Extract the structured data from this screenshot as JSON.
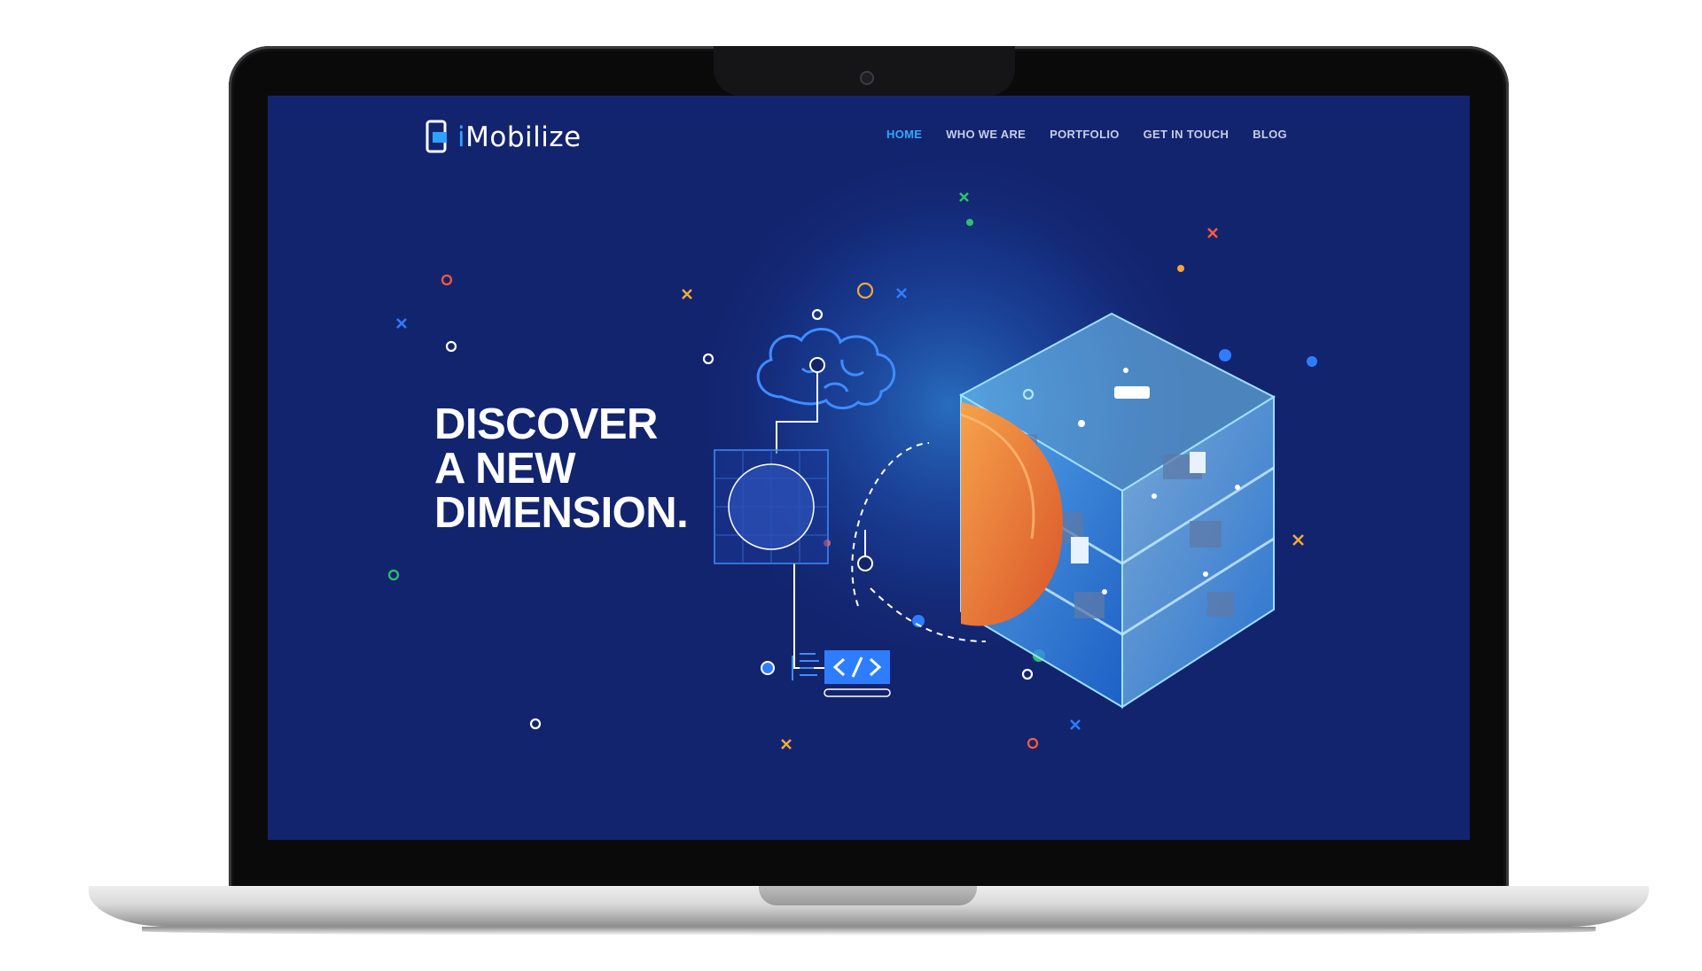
{
  "brand": {
    "prefix": "i",
    "name": "Mobilize"
  },
  "nav": {
    "items": [
      {
        "label": "HOME",
        "active": true
      },
      {
        "label": "WHO WE ARE",
        "active": false
      },
      {
        "label": "PORTFOLIO",
        "active": false
      },
      {
        "label": "GET IN TOUCH",
        "active": false
      },
      {
        "label": "BLOG",
        "active": false
      }
    ]
  },
  "hero": {
    "line1": "DISCOVER",
    "line2": "A NEW",
    "line3": "DIMENSION."
  },
  "colors": {
    "background": "#13246e",
    "accent": "#35a6ff",
    "nav_text": "#c5cde8"
  },
  "icons": [
    "phone-logo-icon",
    "brain-icon",
    "code-icon",
    "isometric-cube-illustration"
  ]
}
